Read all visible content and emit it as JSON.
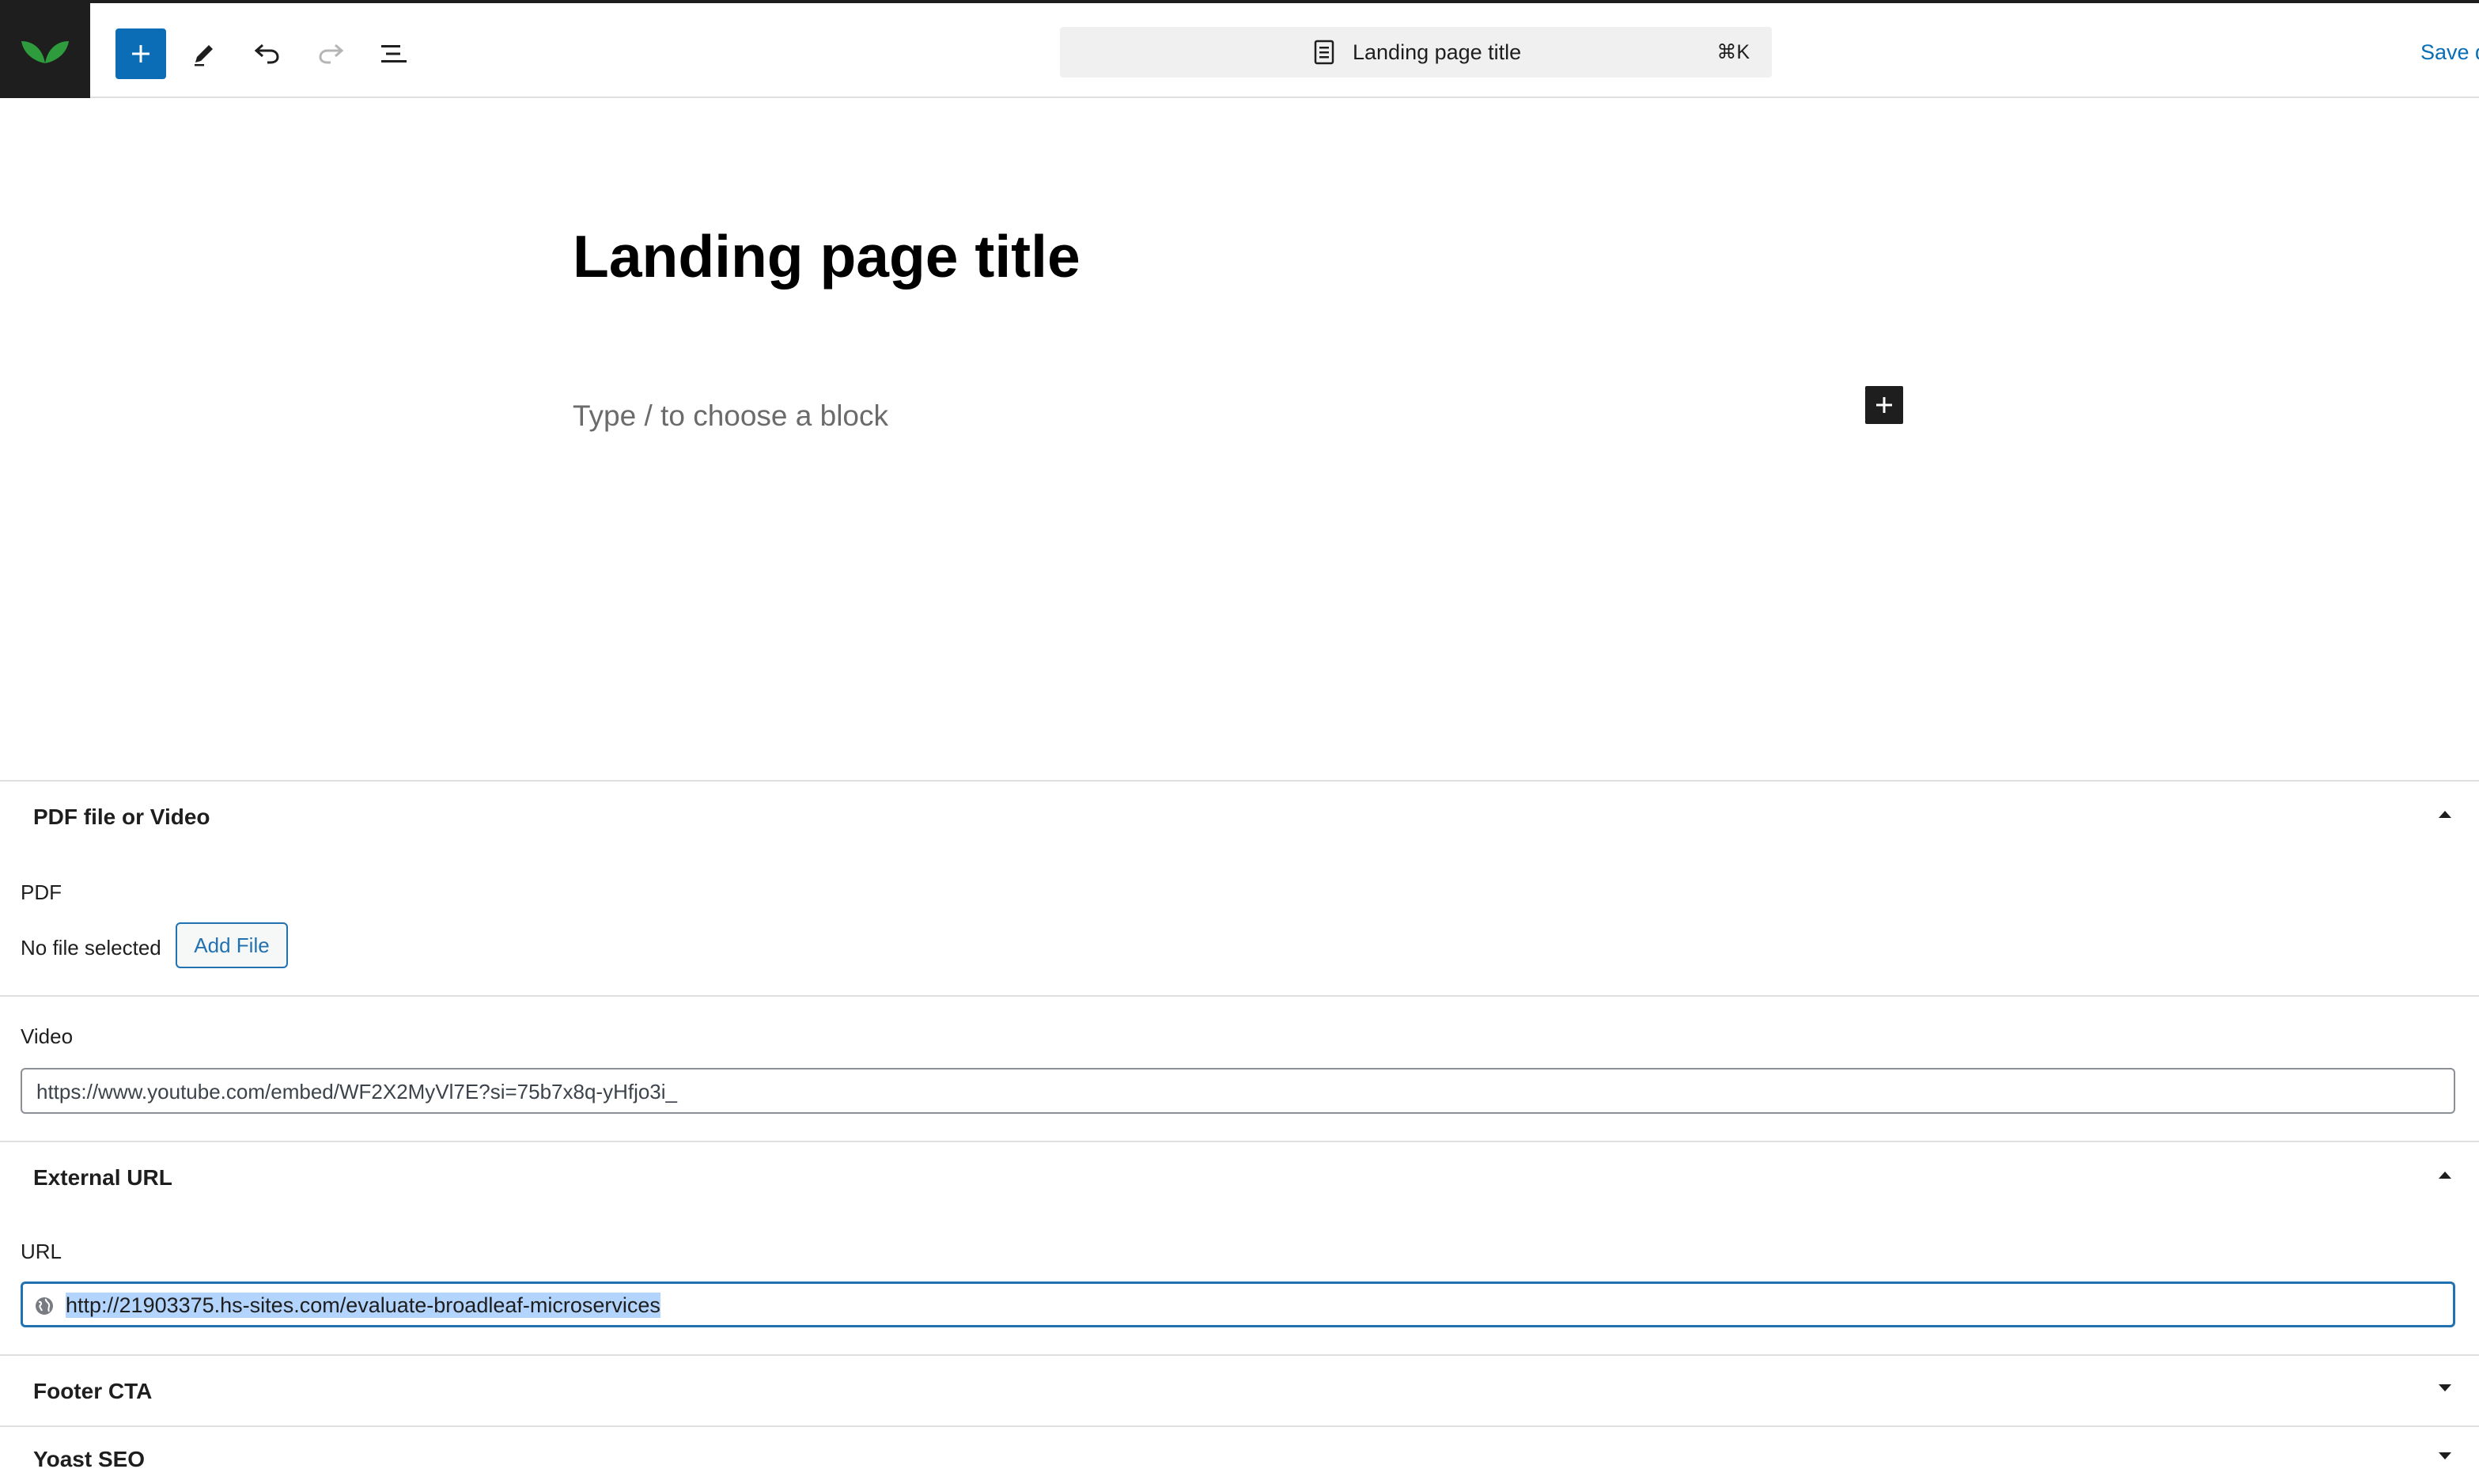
{
  "toolbar": {
    "document_title": "Landing page title",
    "shortcut": "⌘K",
    "save_label": "Save d"
  },
  "editor": {
    "title": "Landing page title",
    "placeholder": "Type / to choose a block"
  },
  "panels": {
    "pdf_video": {
      "title": "PDF file or Video",
      "pdf_label": "PDF",
      "no_file": "No file selected",
      "add_file": "Add File",
      "video_label": "Video",
      "video_value": "https://www.youtube.com/embed/WF2X2MyVl7E?si=75b7x8q-yHfjo3i_"
    },
    "external_url": {
      "title": "External URL",
      "url_label": "URL",
      "url_value": "http://21903375.hs-sites.com/evaluate-broadleaf-microservices"
    },
    "footer_cta": {
      "title": "Footer CTA"
    },
    "yoast_seo": {
      "title": "Yoast SEO"
    }
  },
  "colors": {
    "accent": "#0a6db5",
    "dark": "#1e1e1e",
    "logo_green": "#2e9b3d",
    "selection": "#b3d4fc"
  },
  "icons": [
    "leaf-logo-icon",
    "plus-icon",
    "pencil-icon",
    "undo-icon",
    "redo-icon",
    "list-view-icon",
    "document-icon",
    "globe-icon",
    "chevron-up-icon",
    "chevron-down-icon"
  ]
}
